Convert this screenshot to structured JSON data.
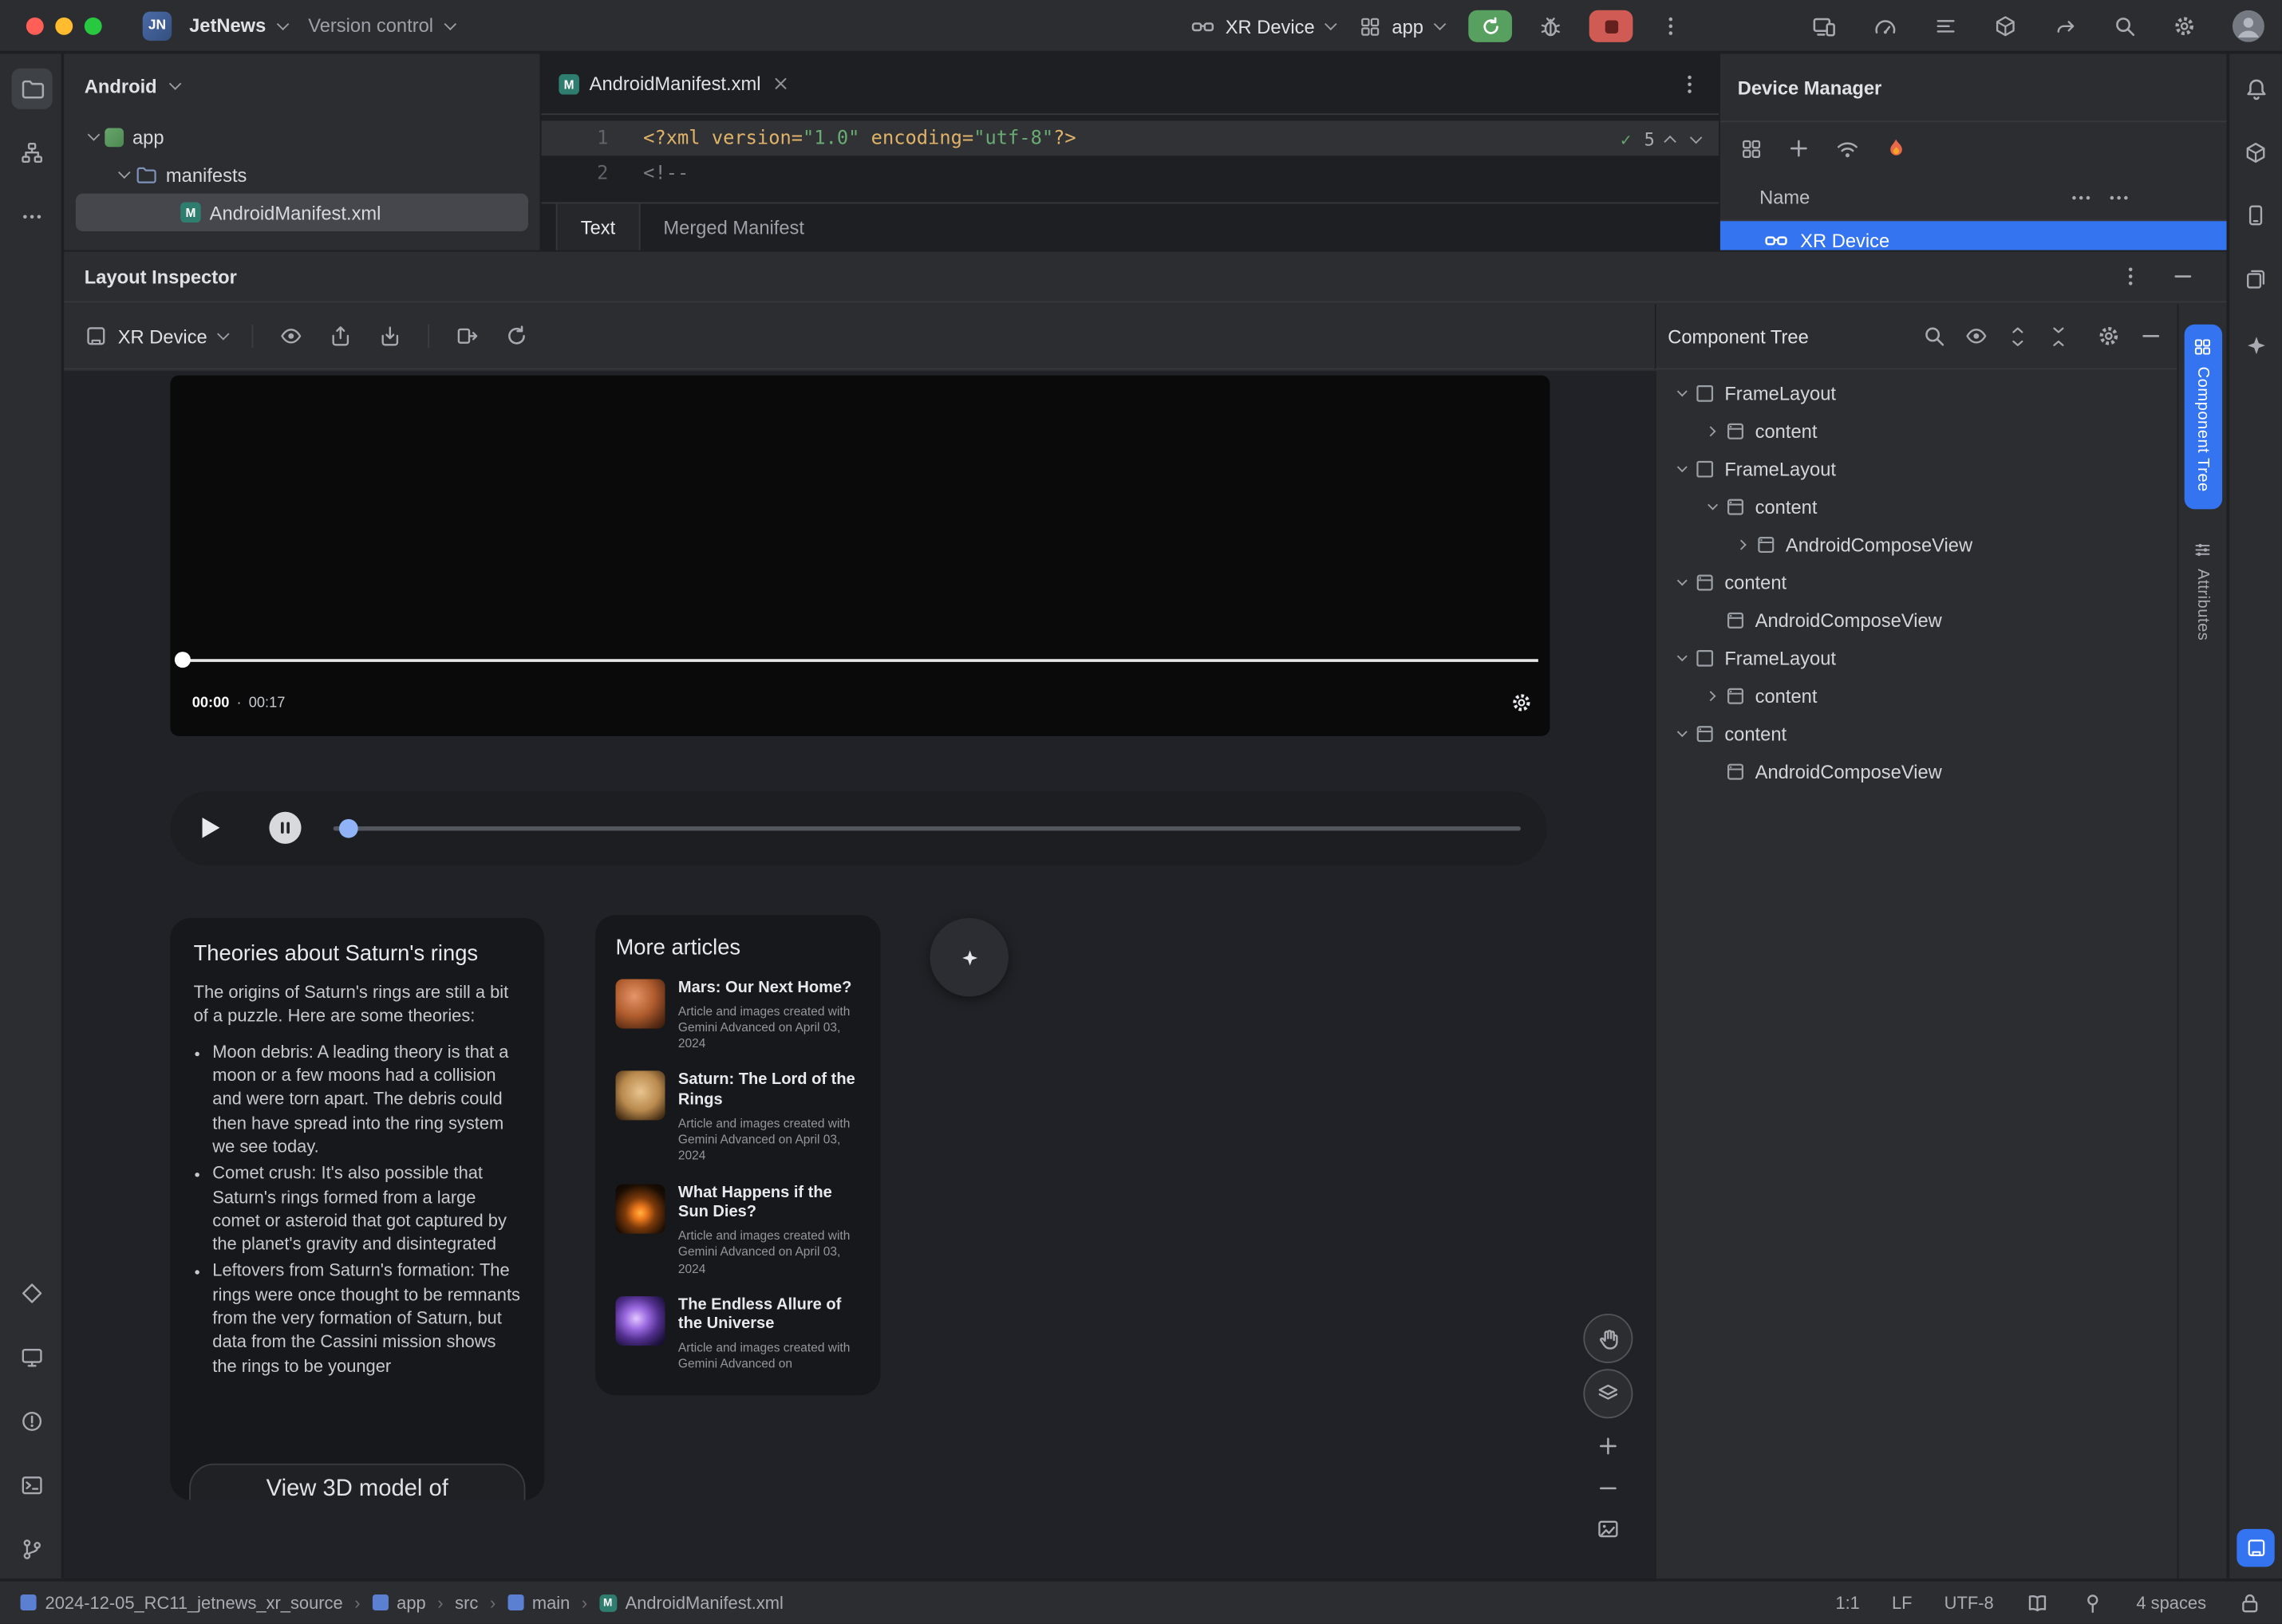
{
  "titlebar": {
    "logo": "JN",
    "project": "JetNews",
    "vcs": "Version control",
    "device": "XR Device",
    "run_config": "app"
  },
  "project": {
    "title": "Android",
    "rows": [
      {
        "label": "app"
      },
      {
        "label": "manifests"
      },
      {
        "label": "AndroidManifest.xml"
      }
    ]
  },
  "editor": {
    "tab": "AndroidManifest.xml",
    "inspections": "5",
    "lines": [
      {
        "n": "1",
        "segs": [
          {
            "t": "<?xml version=",
            "c": "tag"
          },
          {
            "t": "\"1.0\"",
            "c": "str"
          },
          {
            "t": " encoding=",
            "c": "tag"
          },
          {
            "t": "\"utf-8\"",
            "c": "str"
          },
          {
            "t": "?>",
            "c": "tag"
          }
        ]
      },
      {
        "n": "2",
        "segs": [
          {
            "t": "<!--",
            "c": "cmt"
          }
        ]
      }
    ],
    "view_tabs": {
      "text": "Text",
      "merged": "Merged Manifest"
    }
  },
  "device_manager": {
    "title": "Device Manager",
    "name_col": "Name",
    "device_row": "XR Device"
  },
  "inspector": {
    "title": "Layout Inspector",
    "device": "XR Device",
    "tree_title": "Component Tree",
    "side_tabs": [
      "Component Tree",
      "Attributes"
    ],
    "nodes": [
      {
        "label": "FrameLayout",
        "lvl": 0,
        "chev": "down",
        "icon": "frame"
      },
      {
        "label": "content",
        "lvl": 1,
        "chev": "right",
        "icon": "content"
      },
      {
        "label": "FrameLayout",
        "lvl": 0,
        "chev": "down",
        "icon": "frame"
      },
      {
        "label": "content",
        "lvl": 1,
        "chev": "down",
        "icon": "content"
      },
      {
        "label": "AndroidComposeView",
        "lvl": 2,
        "chev": "right",
        "icon": "content"
      },
      {
        "label": "content",
        "lvl": 0,
        "chev": "down",
        "icon": "content"
      },
      {
        "label": "AndroidComposeView",
        "lvl": 1,
        "chev": "none",
        "icon": "content"
      },
      {
        "label": "FrameLayout",
        "lvl": 0,
        "chev": "down",
        "icon": "frame"
      },
      {
        "label": "content",
        "lvl": 1,
        "chev": "right",
        "icon": "content"
      },
      {
        "label": "content",
        "lvl": 0,
        "chev": "down",
        "icon": "content"
      },
      {
        "label": "AndroidComposeView",
        "lvl": 1,
        "chev": "none",
        "icon": "content"
      }
    ]
  },
  "screen": {
    "video": {
      "current": "00:00",
      "separator": "·",
      "total": "00:17"
    },
    "saturn": {
      "title": "Theories about Saturn's rings",
      "intro": "The origins of Saturn's rings are still a bit of a puzzle. Here are some theories:",
      "bullets": [
        "Moon debris: A leading theory is that a moon or a few moons had a collision and were torn apart. The debris could then have spread into the ring system we see today.",
        "Comet crush: It's also possible that Saturn's rings formed from a large comet or asteroid that got captured by the planet's gravity and disintegrated",
        "Leftovers from Saturn's formation: The rings were once thought to be remnants from the very formation of Saturn, but data from the Cassini mission shows the rings to be younger"
      ],
      "button": "View 3D model of"
    },
    "more_articles": {
      "title": "More articles",
      "items": [
        {
          "title": "Mars: Our Next Home?",
          "caption": "Article and images created with Gemini Advanced on April 03, 2024",
          "thumb": "mars"
        },
        {
          "title": "Saturn: The Lord of the Rings",
          "caption": "Article and images created with Gemini Advanced on April 03, 2024",
          "thumb": "saturn"
        },
        {
          "title": "What Happens if the Sun Dies?",
          "caption": "Article and images created with Gemini Advanced on April 03, 2024",
          "thumb": "sun"
        },
        {
          "title": "The Endless Allure of the Universe",
          "caption": "Article and images created with Gemini Advanced on",
          "thumb": "galaxy"
        }
      ]
    }
  },
  "statusbar": {
    "crumbs": [
      {
        "label": "2024-12-05_RC11_jetnews_xr_source",
        "icon": "module"
      },
      {
        "label": "app",
        "icon": "module"
      },
      {
        "label": "src",
        "icon": "none"
      },
      {
        "label": "main",
        "icon": "module"
      },
      {
        "label": "AndroidManifest.xml",
        "icon": "manifest"
      }
    ],
    "caret": "1:1",
    "line_sep": "LF",
    "encoding": "UTF-8",
    "indent": "4 spaces"
  },
  "icons": {
    "manifest_badge": "M"
  },
  "colors": {
    "accent": "#3574f0",
    "run_green": "#57a05f",
    "stop_red": "#d05b55",
    "string_green": "#6aab73",
    "tag_orange": "#e0b368",
    "comment_gray": "#7a7f88",
    "flame_orange": "#e8694a"
  }
}
